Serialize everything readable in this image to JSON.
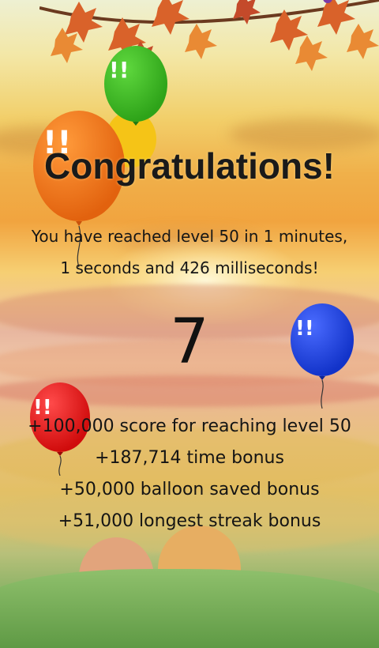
{
  "screen": {
    "title": "Congratulations!",
    "message_line1": "You have reached level 50 in 1 minutes,",
    "message_line2": "1 seconds and 426 milliseconds!",
    "countdown": "7",
    "bonuses": [
      "+100,000 score for reaching level 50",
      "+187,714 time bonus",
      "+50,000 balloon saved bonus",
      "+51,000 longest streak bonus"
    ]
  },
  "balloons": [
    {
      "color": "orange",
      "fill": "#f47a1c",
      "mark": "!!"
    },
    {
      "color": "green",
      "fill": "#3fbf28",
      "mark": "!!"
    },
    {
      "color": "yellow",
      "fill": "#f5c417",
      "mark": ""
    },
    {
      "color": "blue",
      "fill": "#1c46e6",
      "mark": "!!"
    },
    {
      "color": "red",
      "fill": "#ee1616",
      "mark": "!!"
    }
  ],
  "colors": {
    "text": "#161616",
    "leaf": "#d9622a"
  }
}
